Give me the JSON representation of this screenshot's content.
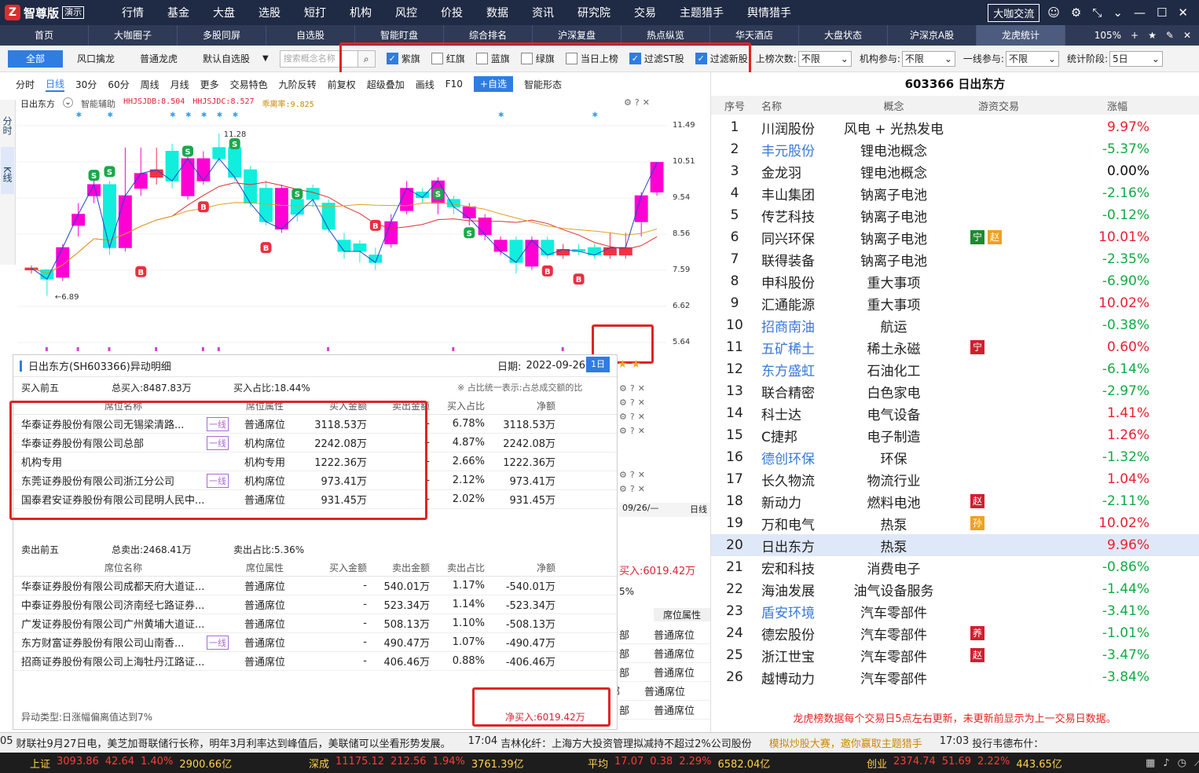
{
  "app": {
    "name": "智尊版",
    "demo": "演示",
    "chat": "大咖交流"
  },
  "menu": [
    "行情",
    "基金",
    "大盘",
    "选股",
    "短打",
    "机构",
    "风控",
    "价投",
    "数据",
    "资讯",
    "研究院",
    "交易",
    "主题猎手",
    "舆情猎手"
  ],
  "tabs": [
    "首页",
    "大咖圈子",
    "多股同屏",
    "自选股",
    "智能盯盘",
    "综合排名",
    "沪深复盘",
    "热点纵览",
    "华天酒店",
    "大盘状态",
    "沪深京A股",
    "龙虎统计"
  ],
  "tab_zoom": "105%",
  "filter": {
    "buttons": [
      "全部",
      "风口擒龙",
      "普通龙虎",
      "默认自选股"
    ],
    "search_placeholder": "搜索概念名称",
    "checks": [
      {
        "label": "紫旗",
        "on": true
      },
      {
        "label": "红旗",
        "on": false
      },
      {
        "label": "蓝旗",
        "on": false
      },
      {
        "label": "绿旗",
        "on": false
      },
      {
        "label": "当日上榜",
        "on": false
      },
      {
        "label": "过滤ST股",
        "on": true
      },
      {
        "label": "过滤新股",
        "on": true
      }
    ],
    "selects": [
      {
        "label": "上榜次数:",
        "value": "不限"
      },
      {
        "label": "机构参与:",
        "value": "不限"
      },
      {
        "label": "一线参与:",
        "value": "不限"
      },
      {
        "label": "统计阶段:",
        "value": "5日"
      }
    ]
  },
  "chart_tb": [
    "分时",
    "日线",
    "30分",
    "60分",
    "周线",
    "月线",
    "更多",
    "交易特色",
    "九阶反转",
    "前复权",
    "超级叠加",
    "画线",
    "F10",
    "+自选",
    "智能形态"
  ],
  "side": [
    "分时",
    "K线"
  ],
  "chart_info": {
    "name": "日出东方",
    "assist": "智能辅助",
    "a": "HHJSJDB:8.504",
    "b": "HHJSJDC:8.527",
    "c": "乖离率:9.825"
  },
  "yaxis": [
    "11.49",
    "10.51",
    "9.54",
    "8.56",
    "7.59",
    "6.62",
    "5.64"
  ],
  "chart_labels": {
    "high": "11.28",
    "low": "6.89"
  },
  "candles": [
    {
      "o": 7.6,
      "c": 7.65,
      "h": 7.72,
      "l": 7.5,
      "u": false
    },
    {
      "o": 7.6,
      "c": 7.35,
      "h": 7.62,
      "l": 6.9,
      "u": false
    },
    {
      "o": 7.4,
      "c": 8.2,
      "h": 8.3,
      "l": 7.3,
      "u": true
    },
    {
      "o": 8.8,
      "c": 9.1,
      "h": 9.4,
      "l": 8.5,
      "u": true
    },
    {
      "o": 9.6,
      "c": 9.9,
      "h": 10.3,
      "l": 9.4,
      "u": true
    },
    {
      "o": 9.9,
      "c": 8.2,
      "h": 10.0,
      "l": 8.0,
      "u": false
    },
    {
      "o": 8.2,
      "c": 9.6,
      "h": 10.9,
      "l": 8.1,
      "u": true
    },
    {
      "o": 9.8,
      "c": 10.2,
      "h": 10.9,
      "l": 9.6,
      "u": true
    },
    {
      "o": 10.1,
      "c": 10.3,
      "h": 10.9,
      "l": 9.9,
      "u": false
    },
    {
      "o": 10.8,
      "c": 10.0,
      "h": 11.0,
      "l": 9.8,
      "u": false
    },
    {
      "o": 9.6,
      "c": 10.6,
      "h": 10.8,
      "l": 9.5,
      "u": true
    },
    {
      "o": 10.6,
      "c": 10.0,
      "h": 10.8,
      "l": 9.9,
      "u": true
    },
    {
      "o": 10.9,
      "c": 10.6,
      "h": 11.28,
      "l": 10.5,
      "u": false
    },
    {
      "o": 10.9,
      "c": 10.1,
      "h": 11.1,
      "l": 10.0,
      "u": false
    },
    {
      "o": 10.3,
      "c": 9.4,
      "h": 10.4,
      "l": 9.3,
      "u": false
    },
    {
      "o": 9.8,
      "c": 8.9,
      "h": 10.0,
      "l": 8.8,
      "u": false
    },
    {
      "o": 9.8,
      "c": 8.7,
      "h": 9.9,
      "l": 8.6,
      "u": true
    },
    {
      "o": 9.5,
      "c": 9.1,
      "h": 9.6,
      "l": 8.9,
      "u": false
    },
    {
      "o": 9.8,
      "c": 9.5,
      "h": 9.9,
      "l": 9.3,
      "u": false
    },
    {
      "o": 9.4,
      "c": 8.7,
      "h": 9.5,
      "l": 8.6,
      "u": false
    },
    {
      "o": 8.4,
      "c": 8.1,
      "h": 8.6,
      "l": 7.9,
      "u": false
    },
    {
      "o": 8.3,
      "c": 8.1,
      "h": 8.4,
      "l": 7.8,
      "u": false
    },
    {
      "o": 8.0,
      "c": 7.8,
      "h": 8.2,
      "l": 7.6,
      "u": false
    },
    {
      "o": 8.3,
      "c": 8.9,
      "h": 9.1,
      "l": 8.2,
      "u": true
    },
    {
      "o": 9.2,
      "c": 9.8,
      "h": 10.0,
      "l": 9.1,
      "u": true
    },
    {
      "o": 9.7,
      "c": 9.55,
      "h": 9.8,
      "l": 9.4,
      "u": false
    },
    {
      "o": 9.4,
      "c": 10.0,
      "h": 10.1,
      "l": 9.1,
      "u": true
    },
    {
      "o": 9.5,
      "c": 9.3,
      "h": 9.6,
      "l": 9.1,
      "u": false
    },
    {
      "o": 9.3,
      "c": 9.0,
      "h": 9.4,
      "l": 8.8,
      "u": true
    },
    {
      "o": 9.0,
      "c": 8.55,
      "h": 9.1,
      "l": 8.4,
      "u": true
    },
    {
      "o": 8.4,
      "c": 8.1,
      "h": 8.5,
      "l": 8.0,
      "u": true
    },
    {
      "o": 8.4,
      "c": 7.8,
      "h": 8.5,
      "l": 7.5,
      "u": false
    },
    {
      "o": 7.7,
      "c": 8.4,
      "h": 8.5,
      "l": 7.6,
      "u": true
    },
    {
      "o": 8.4,
      "c": 8.0,
      "h": 8.5,
      "l": 7.9,
      "u": false
    },
    {
      "o": 8.0,
      "c": 8.15,
      "h": 8.3,
      "l": 7.9,
      "u": false
    },
    {
      "o": 8.15,
      "c": 8.1,
      "h": 8.3,
      "l": 8.0,
      "u": false
    },
    {
      "o": 8.2,
      "c": 8.0,
      "h": 8.3,
      "l": 7.9,
      "u": false
    },
    {
      "o": 8.0,
      "c": 8.2,
      "h": 8.6,
      "l": 7.9,
      "u": false
    },
    {
      "o": 8.0,
      "c": 8.2,
      "h": 8.6,
      "l": 7.9,
      "u": false
    },
    {
      "o": 8.9,
      "c": 9.6,
      "h": 9.7,
      "l": 8.5,
      "u": true
    },
    {
      "o": 9.7,
      "c": 10.5,
      "h": 10.5,
      "l": 9.6,
      "u": true
    }
  ],
  "detail": {
    "title": "日出东方(SH603366)异动明细",
    "date_label": "日期:",
    "date": "2022-09-26",
    "buy_title": "买入前五",
    "buy_total": "总买入:8487.83万",
    "buy_ratio": "买入占比:18.44%",
    "note": "※  占比统一表示:占总成交额的比",
    "cols": [
      "席位名称",
      "席位属性",
      "买入金额",
      "卖出金额",
      "买入占比",
      "净额"
    ],
    "buy_rows": [
      {
        "name": "华泰证券股份有限公司无锡梁清路...",
        "tag": "一线",
        "attr": "普通席位",
        "buy": "3118.53万",
        "sell": "-",
        "ratio": "6.78%",
        "net": "3118.53万"
      },
      {
        "name": "华泰证券股份有限公司总部",
        "tag": "一线",
        "attr": "机构席位",
        "buy": "2242.08万",
        "sell": "-",
        "ratio": "4.87%",
        "net": "2242.08万"
      },
      {
        "name": "机构专用",
        "tag": "",
        "attr": "机构专用",
        "buy": "1222.36万",
        "sell": "-",
        "ratio": "2.66%",
        "net": "1222.36万"
      },
      {
        "name": "东莞证券股份有限公司浙江分公司",
        "tag": "一线",
        "attr": "机构席位",
        "buy": "973.41万",
        "sell": "-",
        "ratio": "2.12%",
        "net": "973.41万"
      },
      {
        "name": "国泰君安证券股份有限公司昆明人民中...",
        "tag": "",
        "attr": "普通席位",
        "buy": "931.45万",
        "sell": "-",
        "ratio": "2.02%",
        "net": "931.45万"
      }
    ],
    "sell_title": "卖出前五",
    "sell_total": "总卖出:2468.41万",
    "sell_ratio": "卖出占比:5.36%",
    "sell_cols": [
      "席位名称",
      "席位属性",
      "买入金额",
      "卖出金额",
      "卖出占比",
      "净额"
    ],
    "sell_rows": [
      {
        "name": "华泰证券股份有限公司成都天府大道证...",
        "tag": "",
        "attr": "普通席位",
        "buy": "-",
        "sell": "540.01万",
        "ratio": "1.17%",
        "net": "-540.01万"
      },
      {
        "name": "中泰证券股份有限公司济南经七路证券...",
        "tag": "",
        "attr": "普通席位",
        "buy": "-",
        "sell": "523.34万",
        "ratio": "1.14%",
        "net": "-523.34万"
      },
      {
        "name": "广发证券股份有限公司广州黄埔大道证...",
        "tag": "",
        "attr": "普通席位",
        "buy": "-",
        "sell": "508.13万",
        "ratio": "1.10%",
        "net": "-508.13万"
      },
      {
        "name": "东方财富证券股份有限公司山南香...",
        "tag": "一线",
        "attr": "普通席位",
        "buy": "-",
        "sell": "490.47万",
        "ratio": "1.07%",
        "net": "-490.47万"
      },
      {
        "name": "招商证券股份有限公司上海牡丹江路证...",
        "tag": "",
        "attr": "普通席位",
        "buy": "-",
        "sell": "406.46万",
        "ratio": "0.88%",
        "net": "-406.46万"
      }
    ],
    "type": "异动类型:日涨幅偏离值达到7%",
    "net_buy": "净买入:6019.42万"
  },
  "behind": {
    "a": "买入:6019.42万",
    "b": "5%",
    "c": "席位属性",
    "rows": [
      "普通席位",
      "普通席位",
      "普通席位",
      "普通席位",
      "普通席位"
    ],
    "tag": "一线",
    "date": "09/26/—",
    "dlabel": "日线"
  },
  "right": {
    "title": "603366  日出东方",
    "cols": [
      "序号",
      "名称",
      "概念",
      "游资交易",
      "涨幅"
    ],
    "rows": [
      {
        "n": "1",
        "name": "川润股份",
        "link": false,
        "concept": "风电 + 光热发电",
        "badges": [],
        "chg": "9.97%",
        "up": true
      },
      {
        "n": "2",
        "name": "丰元股份",
        "link": true,
        "concept": "锂电池概念",
        "badges": [],
        "chg": "-5.37%",
        "up": false
      },
      {
        "n": "3",
        "name": "金龙羽",
        "link": false,
        "concept": "锂电池概念",
        "badges": [],
        "chg": "0.00%",
        "up": null
      },
      {
        "n": "4",
        "name": "丰山集团",
        "link": false,
        "concept": "钠离子电池",
        "badges": [],
        "chg": "-2.16%",
        "up": false
      },
      {
        "n": "5",
        "name": "传艺科技",
        "link": false,
        "concept": "钠离子电池",
        "badges": [],
        "chg": "-0.12%",
        "up": false
      },
      {
        "n": "6",
        "name": "同兴环保",
        "link": false,
        "concept": "钠离子电池",
        "badges": [
          {
            "t": "宁",
            "c": "#1e8a2e"
          },
          {
            "t": "赵",
            "c": "#f0a020"
          }
        ],
        "chg": "10.01%",
        "up": true
      },
      {
        "n": "7",
        "name": "联得装备",
        "link": false,
        "concept": "钠离子电池",
        "badges": [],
        "chg": "-2.35%",
        "up": false
      },
      {
        "n": "8",
        "name": "申科股份",
        "link": false,
        "concept": "重大事项",
        "badges": [],
        "chg": "-6.90%",
        "up": false
      },
      {
        "n": "9",
        "name": "汇通能源",
        "link": false,
        "concept": "重大事项",
        "badges": [],
        "chg": "10.02%",
        "up": true
      },
      {
        "n": "10",
        "name": "招商南油",
        "link": true,
        "concept": "航运",
        "badges": [],
        "chg": "-0.38%",
        "up": false
      },
      {
        "n": "11",
        "name": "五矿稀土",
        "link": true,
        "concept": "稀土永磁",
        "badges": [
          {
            "t": "宁",
            "c": "#d01f2f"
          }
        ],
        "chg": "0.60%",
        "up": true
      },
      {
        "n": "12",
        "name": "东方盛虹",
        "link": true,
        "concept": "石油化工",
        "badges": [],
        "chg": "-6.14%",
        "up": false
      },
      {
        "n": "13",
        "name": "联合精密",
        "link": false,
        "concept": "白色家电",
        "badges": [],
        "chg": "-2.97%",
        "up": false
      },
      {
        "n": "14",
        "name": "科士达",
        "link": false,
        "concept": "电气设备",
        "badges": [],
        "chg": "1.41%",
        "up": true
      },
      {
        "n": "15",
        "name": "C捷邦",
        "link": false,
        "concept": "电子制造",
        "badges": [],
        "chg": "1.26%",
        "up": true
      },
      {
        "n": "16",
        "name": "德创环保",
        "link": true,
        "concept": "环保",
        "badges": [],
        "chg": "-1.32%",
        "up": false
      },
      {
        "n": "17",
        "name": "长久物流",
        "link": false,
        "concept": "物流行业",
        "badges": [],
        "chg": "1.04%",
        "up": true
      },
      {
        "n": "18",
        "name": "新动力",
        "link": false,
        "concept": "燃料电池",
        "badges": [
          {
            "t": "赵",
            "c": "#d01f2f"
          }
        ],
        "chg": "-2.11%",
        "up": false
      },
      {
        "n": "19",
        "name": "万和电气",
        "link": false,
        "concept": "热泵",
        "badges": [
          {
            "t": "孙",
            "c": "#f0a020"
          }
        ],
        "chg": "10.02%",
        "up": true
      },
      {
        "n": "20",
        "name": "日出东方",
        "link": false,
        "concept": "热泵",
        "badges": [],
        "chg": "9.96%",
        "up": true,
        "hl": true
      },
      {
        "n": "21",
        "name": "宏和科技",
        "link": false,
        "concept": "消费电子",
        "badges": [],
        "chg": "-0.86%",
        "up": false
      },
      {
        "n": "22",
        "name": "海油发展",
        "link": false,
        "concept": "油气设备服务",
        "badges": [],
        "chg": "-1.44%",
        "up": false
      },
      {
        "n": "23",
        "name": "盾安环境",
        "link": true,
        "concept": "汽车零部件",
        "badges": [],
        "chg": "-3.41%",
        "up": false
      },
      {
        "n": "24",
        "name": "德宏股份",
        "link": false,
        "concept": "汽车零部件",
        "badges": [
          {
            "t": "养",
            "c": "#d01f2f"
          }
        ],
        "chg": "-1.01%",
        "up": false
      },
      {
        "n": "25",
        "name": "浙江世宝",
        "link": false,
        "concept": "汽车零部件",
        "badges": [
          {
            "t": "赵",
            "c": "#d01f2f"
          }
        ],
        "chg": "-3.47%",
        "up": false
      },
      {
        "n": "26",
        "name": "越博动力",
        "link": false,
        "concept": "汽车零部件",
        "badges": [],
        "chg": "-3.84%",
        "up": false
      }
    ],
    "note": "龙虎榜数据每个交易日5点左右更新，未更新前显示为上一交易日数据。"
  },
  "news": [
    {
      "t": "05",
      "s": "财联社9月27日电，美芝加哥联储行长称，明年3月利率达到峰值后，美联储可以坐看形势发展。"
    },
    {
      "t": "17:04",
      "s": "吉林化纤：上海方大投资管理拟减持不超过2%公司股份"
    },
    {
      "t": "",
      "s": "模拟炒股大赛，邀你赢取主题猎手"
    },
    {
      "t": "17:03",
      "s": "投行韦德布什："
    }
  ],
  "indices": [
    {
      "name": "上证",
      "v": "3093.86",
      "d": "42.64",
      "p": "1.40%",
      "amt": "2900.66亿"
    },
    {
      "name": "深成",
      "v": "11175.12",
      "d": "212.56",
      "p": "1.94%",
      "amt": "3761.39亿"
    },
    {
      "name": "平均",
      "v": "17.07",
      "d": "0.38",
      "p": "2.29%",
      "amt": "6582.04亿"
    },
    {
      "name": "创业",
      "v": "2374.74",
      "d": "51.69",
      "p": "2.22%",
      "amt": "443.65亿"
    }
  ]
}
